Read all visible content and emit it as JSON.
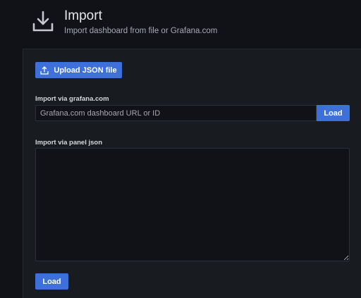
{
  "header": {
    "icon": "download-icon",
    "title": "Import",
    "subtitle": "Import dashboard from file or Grafana.com"
  },
  "upload": {
    "icon": "upload-icon",
    "label": "Upload JSON file"
  },
  "grafana_import": {
    "label": "Import via grafana.com",
    "placeholder": "Grafana.com dashboard URL or ID",
    "value": "",
    "load_label": "Load"
  },
  "json_import": {
    "label": "Import via panel json",
    "value": ""
  },
  "footer": {
    "load_label": "Load"
  },
  "colors": {
    "background": "#111217",
    "panel": "#181b1f",
    "primary_button": "#3d71d9"
  }
}
